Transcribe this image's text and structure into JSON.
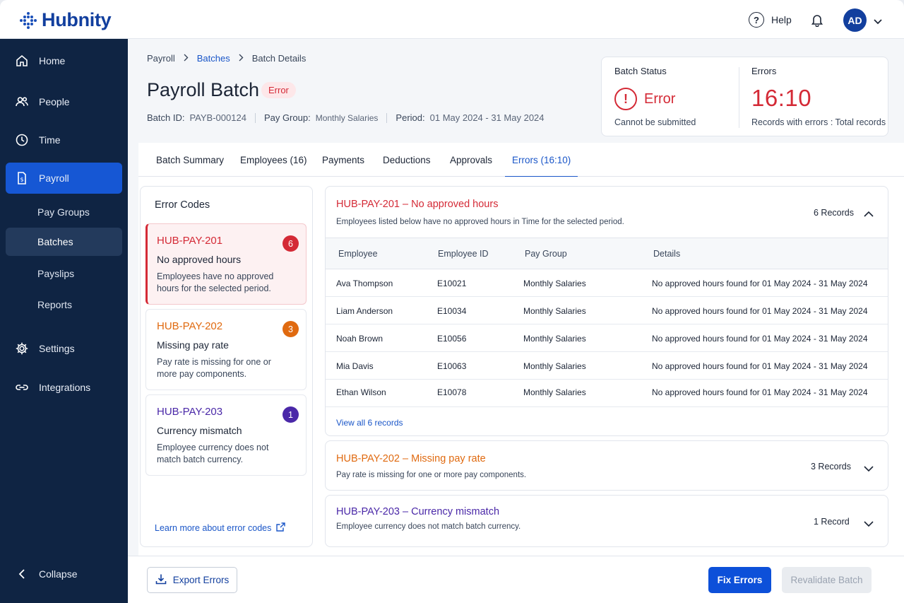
{
  "app": {
    "brand": "Hubnity",
    "help_label": "Help",
    "avatar_initials": "AD"
  },
  "sidebar": {
    "items": [
      {
        "label": "Home",
        "icon": "home-icon"
      },
      {
        "label": "People",
        "icon": "people-icon"
      },
      {
        "label": "Time",
        "icon": "clock-icon"
      },
      {
        "label": "Payroll",
        "icon": "payroll-doc-icon",
        "active": true
      },
      {
        "label": "Settings",
        "icon": "gear-icon"
      },
      {
        "label": "Integrations",
        "icon": "link-icon"
      }
    ],
    "sub_items": [
      {
        "label": "Pay Groups"
      },
      {
        "label": "Batches",
        "active": true
      },
      {
        "label": "Payslips"
      },
      {
        "label": "Reports"
      }
    ],
    "collapse_label": "Collapse"
  },
  "breadcrumb": {
    "items": [
      "Payroll",
      "Batches",
      "Batch Details"
    ]
  },
  "page": {
    "title": "Payroll Batch",
    "status_badge": "Error",
    "meta": {
      "batch_id_label": "Batch ID:",
      "batch_id": "PAYB-000124",
      "pay_group_label": "Pay Group:",
      "pay_group": "Monthly Salaries",
      "period_label": "Period:",
      "period": "01 May 2024 - 31 May 2024"
    }
  },
  "status_card": {
    "status_label": "Batch Status",
    "status_value": "Error",
    "status_sub": "Cannot be submitted",
    "errors_label": "Errors",
    "errors_value": "16:10",
    "errors_sub": "Records with errors : Total records"
  },
  "tabs": [
    {
      "label": "Batch Summary"
    },
    {
      "label": "Employees (16)"
    },
    {
      "label": "Payments"
    },
    {
      "label": "Deductions"
    },
    {
      "label": "Approvals"
    },
    {
      "label": "Errors (16:10)",
      "active": true
    }
  ],
  "error_codes": {
    "title": "Error Codes",
    "cards": [
      {
        "code": "HUB-PAY-201",
        "name": "No approved hours",
        "desc": "Employees have no approved hours for the selected period.",
        "count": "6",
        "color": "#d42a36"
      },
      {
        "code": "HUB-PAY-202",
        "name": "Missing pay rate",
        "desc": "Pay rate is missing for one or more pay components.",
        "count": "3",
        "color": "#e06a10"
      },
      {
        "code": "HUB-PAY-203",
        "name": "Currency mismatch",
        "desc": "Employee currency does not match batch currency.",
        "count": "1",
        "color": "#4a28a8"
      }
    ],
    "learn_more": "Learn more about error codes"
  },
  "panels": [
    {
      "title": "HUB-PAY-201 – No approved hours",
      "desc": "Employees listed below have no approved hours in Time for the selected period.",
      "count_label": "6 Records",
      "expanded": true,
      "columns": [
        "Employee",
        "Employee ID",
        "Pay Group",
        "Details"
      ],
      "rows": [
        [
          "Ava Thompson",
          "E10021",
          "Monthly Salaries",
          "No approved hours found for 01 May 2024 - 31 May 2024"
        ],
        [
          "Liam Anderson",
          "E10034",
          "Monthly Salaries",
          "No approved hours found for 01 May 2024 - 31 May 2024"
        ],
        [
          "Noah Brown",
          "E10056",
          "Monthly Salaries",
          "No approved hours found for 01 May 2024 - 31 May 2024"
        ],
        [
          "Mia Davis",
          "E10063",
          "Monthly Salaries",
          "No approved hours found for 01 May 2024 - 31 May 2024"
        ],
        [
          "Ethan Wilson",
          "E10078",
          "Monthly Salaries",
          "No approved hours found for 01 May 2024 - 31 May 2024"
        ]
      ],
      "view_all": "View all 6 records"
    },
    {
      "title": "HUB-PAY-202 – Missing pay rate",
      "desc": "Pay rate is missing for one or more pay components.",
      "count_label": "3 Records",
      "expanded": false
    },
    {
      "title": "HUB-PAY-203 – Currency mismatch",
      "desc": "Employee currency does not match batch currency.",
      "count_label": "1 Record",
      "expanded": false
    }
  ],
  "footer": {
    "export_label": "Export Errors",
    "fix_label": "Fix Errors",
    "revalidate_label": "Revalidate Batch"
  },
  "colors": {
    "brand": "#123f9e",
    "error": "#d42a36",
    "warning": "#e06a10",
    "purple": "#4a28a8",
    "primary": "#0d50d9"
  }
}
